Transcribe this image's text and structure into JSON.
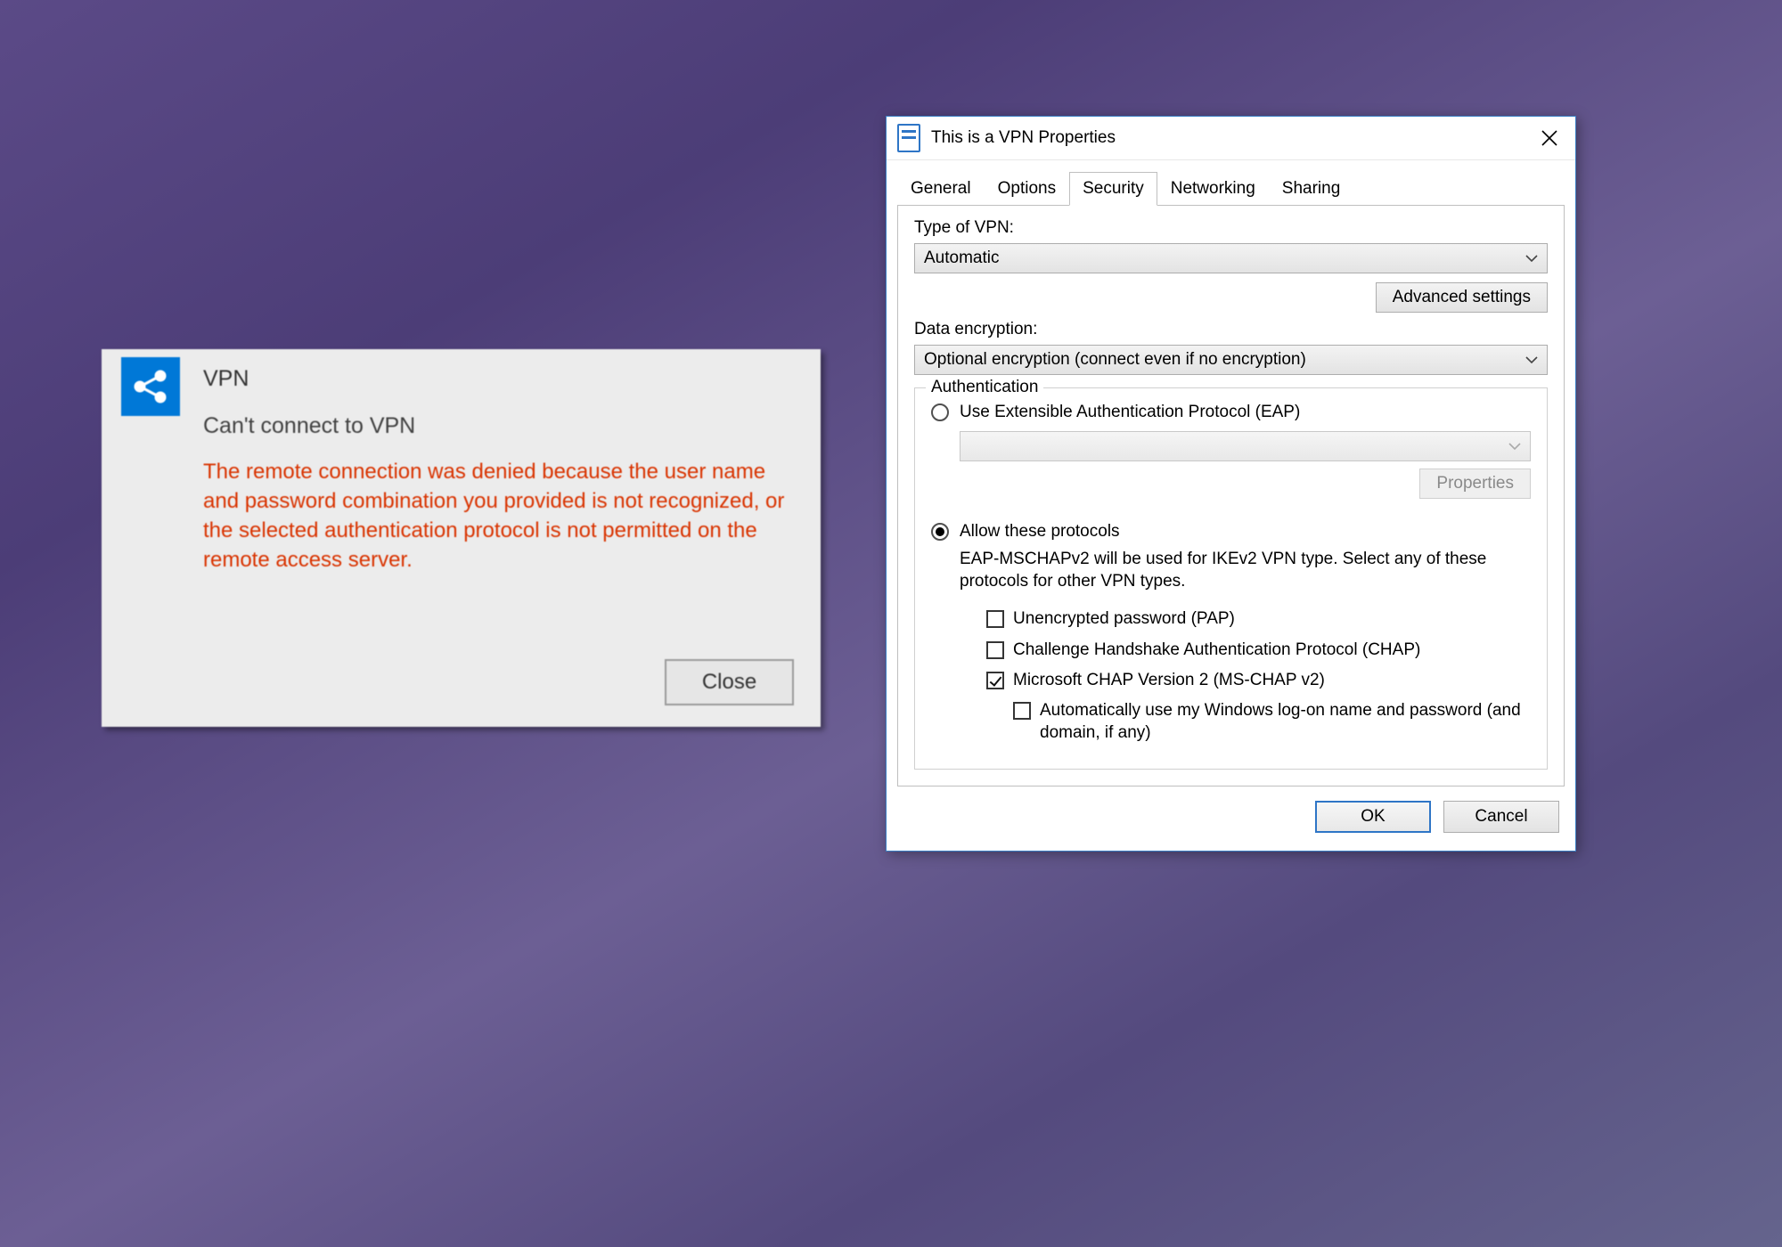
{
  "notification": {
    "title": "VPN",
    "heading": "Can't connect to VPN",
    "message": "The remote connection was denied because the user name and password combination you provided is not recognized, or the selected authentication protocol is not permitted on the remote access server.",
    "close_label": "Close",
    "icon": "share-icon"
  },
  "dialog": {
    "title": "This is a VPN Properties",
    "tabs": {
      "general": "General",
      "options": "Options",
      "security": "Security",
      "networking": "Networking",
      "sharing": "Sharing"
    },
    "active_tab": "security",
    "security": {
      "type_label": "Type of VPN:",
      "type_value": "Automatic",
      "advanced_btn": "Advanced settings",
      "encryption_label": "Data encryption:",
      "encryption_value": "Optional encryption (connect even if no encryption)",
      "auth_group_label": "Authentication",
      "eap_radio_label": "Use Extensible Authentication Protocol (EAP)",
      "eap_props_btn": "Properties",
      "allow_radio_label": "Allow these protocols",
      "allow_note": "EAP-MSCHAPv2 will be used for IKEv2 VPN type. Select any of these protocols for other VPN types.",
      "pap_label": "Unencrypted password (PAP)",
      "chap_label": "Challenge Handshake Authentication Protocol (CHAP)",
      "mschap_label": "Microsoft CHAP Version 2 (MS-CHAP v2)",
      "autologon_label": "Automatically use my Windows log-on name and password (and domain, if any)",
      "pap_checked": false,
      "chap_checked": false,
      "mschap_checked": true,
      "autologon_checked": false,
      "selected_auth_radio": "allow"
    },
    "footer": {
      "ok_label": "OK",
      "cancel_label": "Cancel"
    }
  }
}
